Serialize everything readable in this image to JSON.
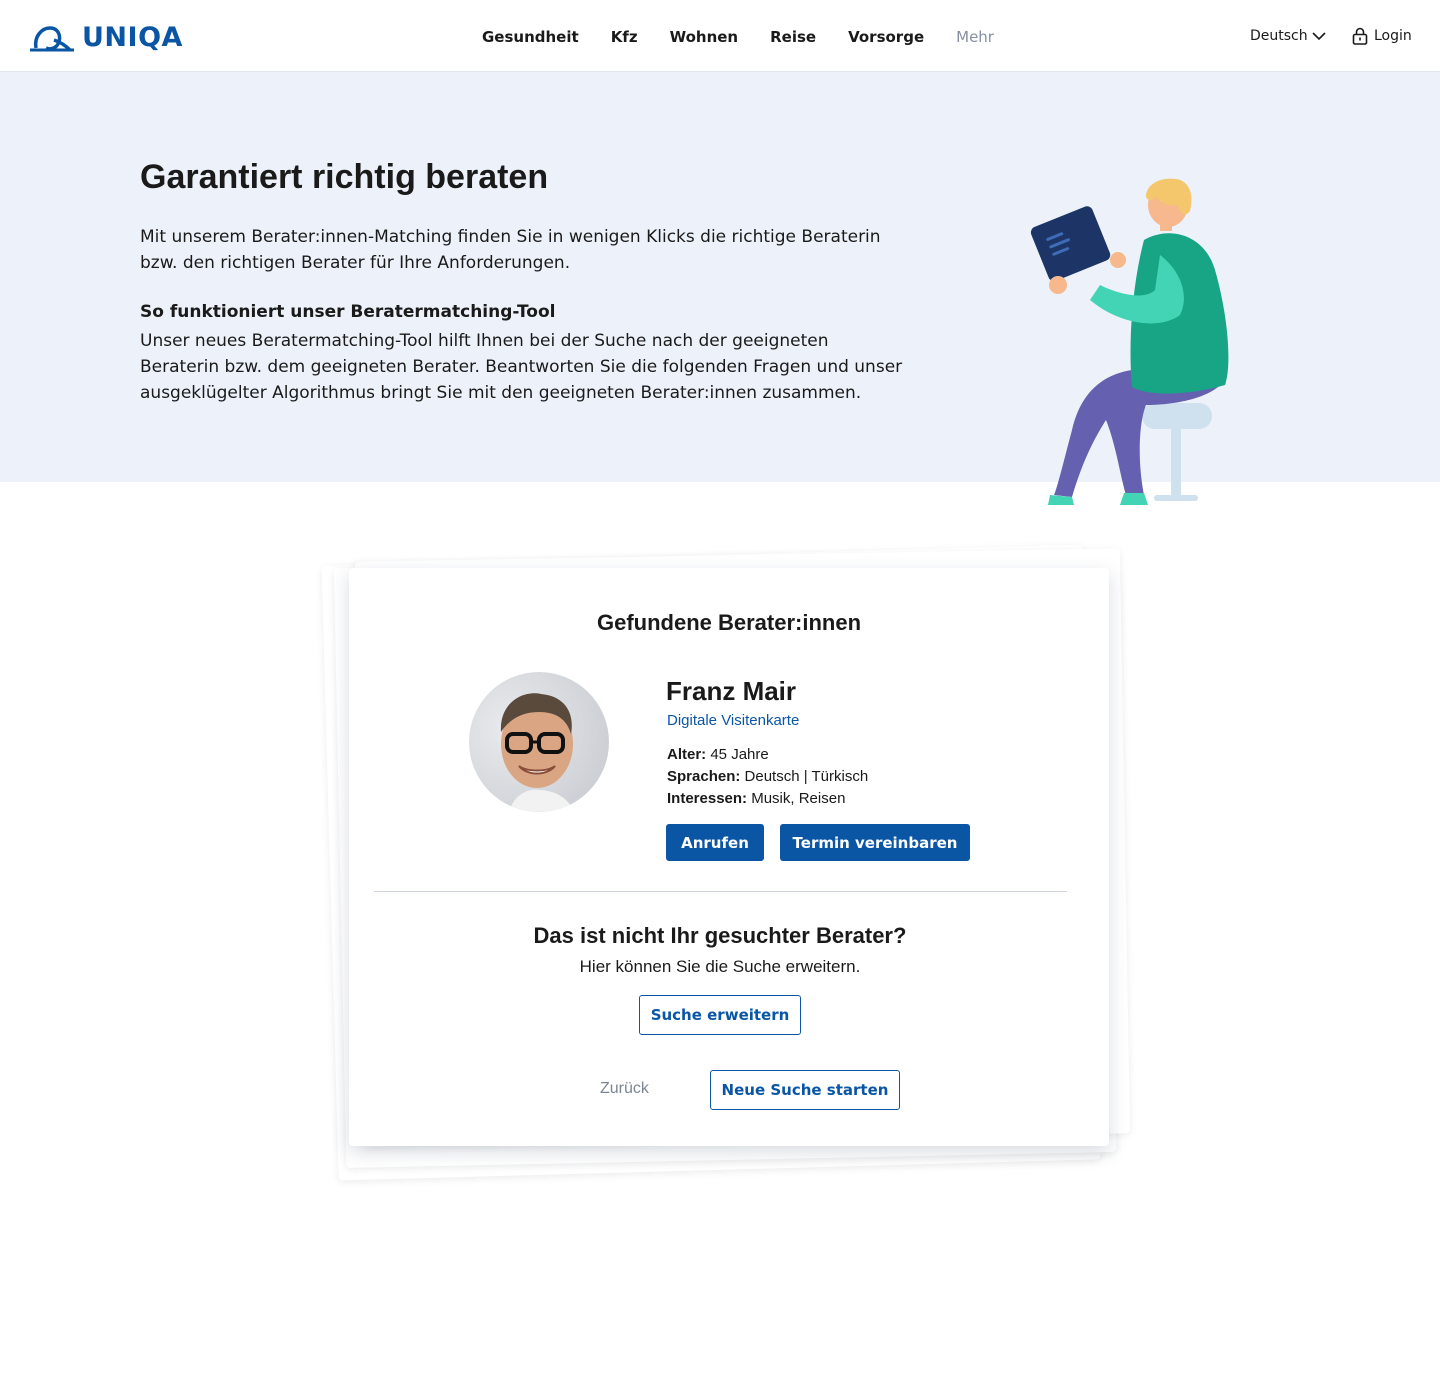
{
  "header": {
    "logo_text": "UNIQA",
    "nav": [
      "Gesundheit",
      "Kfz",
      "Wohnen",
      "Reise",
      "Vorsorge",
      "Mehr"
    ],
    "language": "Deutsch",
    "login": "Login"
  },
  "hero": {
    "title": "Garantiert richtig beraten",
    "intro": "Mit unserem Berater:innen-Matching finden Sie in wenigen Klicks die richtige Beraterin bzw. den richtigen Berater für Ihre Anforderungen.",
    "subtitle": "So funktioniert unser Beratermatching-Tool",
    "subtext": "Unser neues Beratermatching-Tool hilft Ihnen bei der Suche nach der geeigneten Beraterin bzw. dem geeigneten Berater. Beantworten Sie die folgenden Fragen und unser ausgeklügelter Algorithmus bringt Sie mit den geeigneten Berater:innen zusammen."
  },
  "result": {
    "title": "Gefundene Berater:innen",
    "advisor": {
      "name": "Franz Mair",
      "card_link": "Digitale Visitenkarte",
      "age_label": "Alter:",
      "age_value": "45 Jahre",
      "languages_label": "Sprachen:",
      "languages_value": "Deutsch | Türkisch",
      "interests_label": "Interessen:",
      "interests_value": "Musik, Reisen"
    },
    "call_button": "Anrufen",
    "appointment_button": "Termin vereinbaren",
    "not_found_title": "Das ist nicht Ihr gesuchter Berater?",
    "not_found_text": "Hier können Sie die Suche erweitern.",
    "extend_button": "Suche erweitern",
    "back_link": "Zurück",
    "new_search_button": "Neue Suche starten"
  },
  "colors": {
    "brand_blue": "#0a56a5",
    "hero_bg": "#edf2fa"
  }
}
